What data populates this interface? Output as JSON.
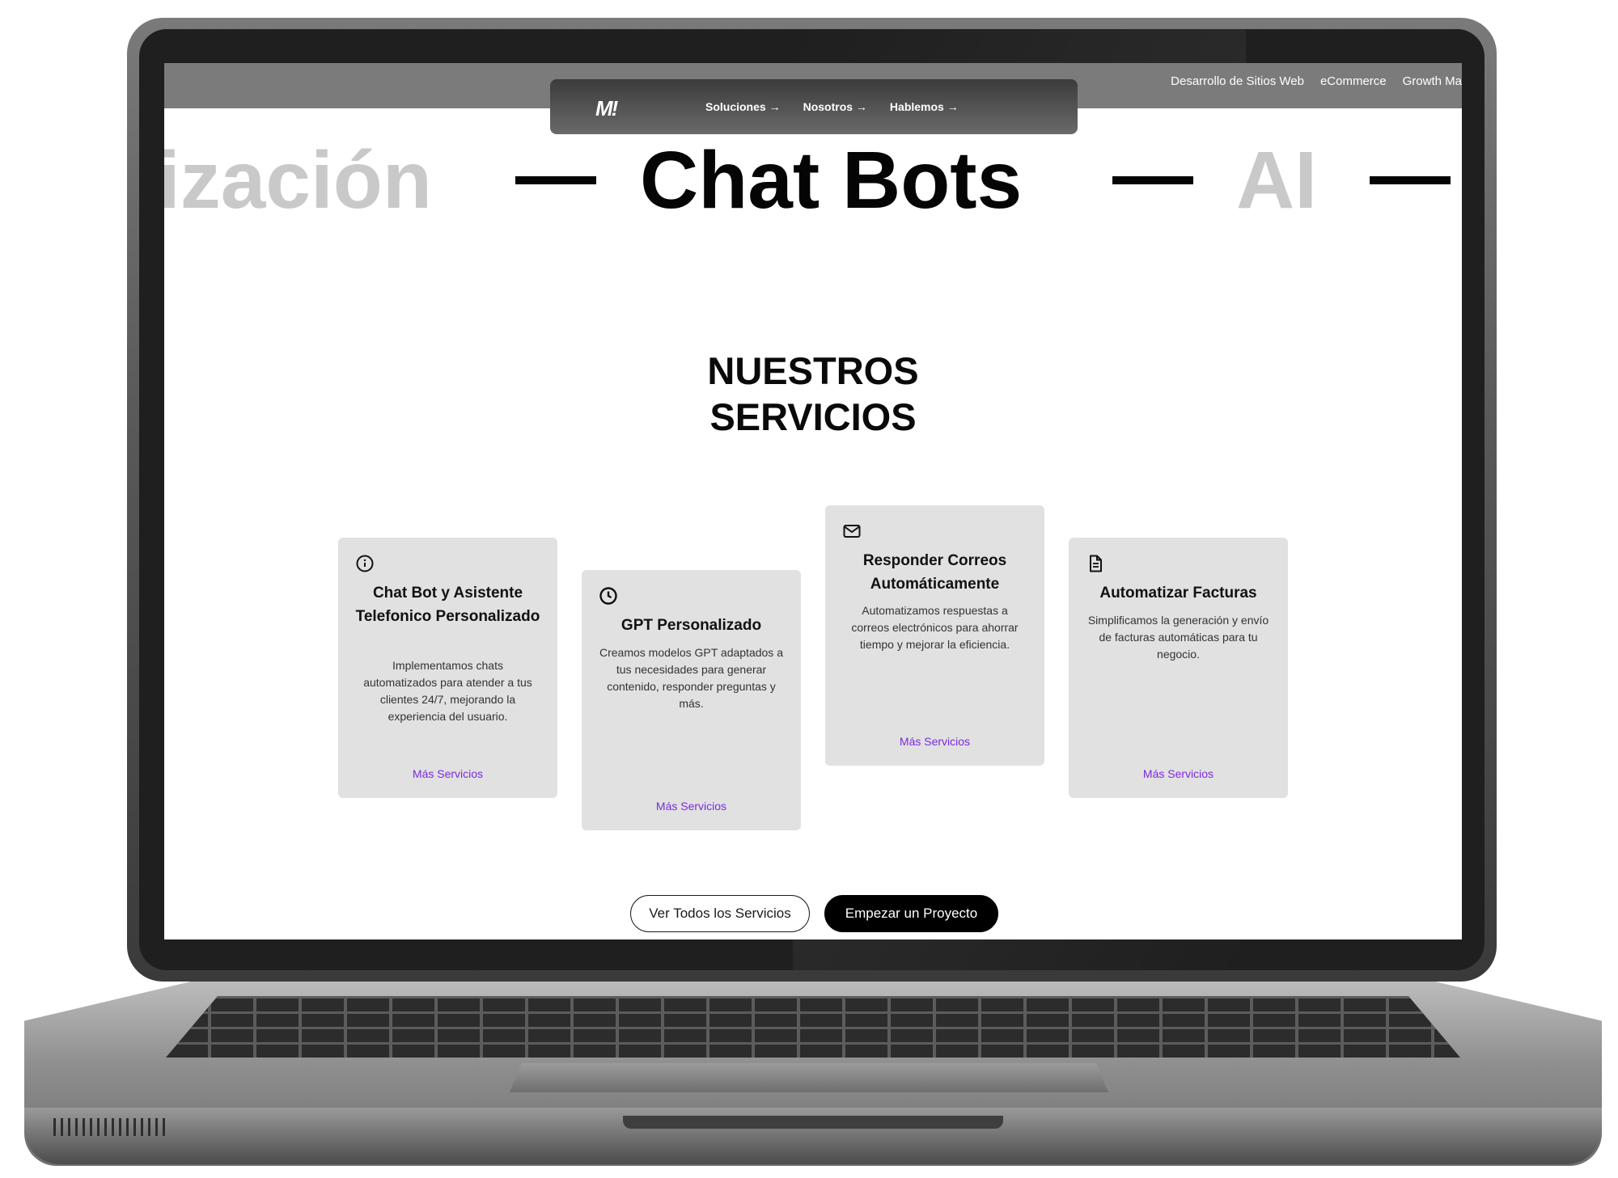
{
  "top_links": [
    "Desarrollo de Sitios Web",
    "eCommerce",
    "Growth Ma"
  ],
  "nav": {
    "logo": "M!",
    "items": [
      "Soluciones →",
      "Nosotros →",
      "Hablemos →"
    ]
  },
  "marquee": {
    "left": "ización",
    "center": "Chat Bots",
    "right": "AI"
  },
  "section": {
    "title_line1": "NUESTROS",
    "title_line2": "SERVICIOS"
  },
  "cards": [
    {
      "icon": "info-circle-icon",
      "title": "Chat Bot y Asistente Telefonico Personalizado",
      "description": "Implementamos chats automatizados para atender a tus clientes 24/7, mejorando la experiencia del usuario.",
      "link": "Más Servicios"
    },
    {
      "icon": "clock-icon",
      "title": "GPT Personalizado",
      "description": "Creamos modelos GPT adaptados a tus necesidades para generar contenido, responder preguntas y más.",
      "link": "Más Servicios"
    },
    {
      "icon": "mail-icon",
      "title": "Responder Correos Automáticamente",
      "description": "Automatizamos respuestas a correos electrónicos para ahorrar tiempo y mejorar la eficiencia.",
      "link": "Más Servicios"
    },
    {
      "icon": "document-icon",
      "title": "Automatizar Facturas",
      "description": "Simplificamos la generación y envío de facturas automáticas para tu negocio.",
      "link": "Más Servicios"
    }
  ],
  "buttons": {
    "secondary": "Ver Todos los Servicios",
    "primary": "Empezar un Proyecto"
  },
  "colors": {
    "link": "#7a2be0",
    "card_bg": "#e1e1e1",
    "nav_bg": "#3b3b3b"
  }
}
